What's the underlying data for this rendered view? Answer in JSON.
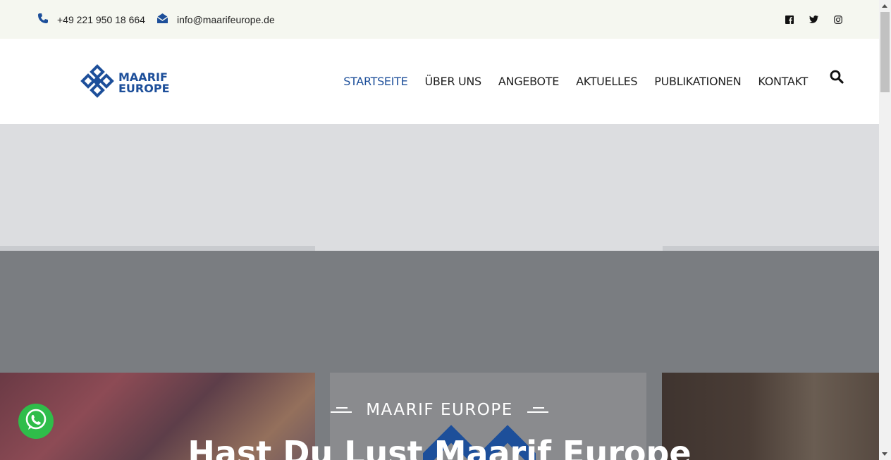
{
  "topbar": {
    "phone": "+49 221 950 18 664",
    "email": "info@maarifeurope.de",
    "social_icons": [
      "facebook-icon",
      "twitter-icon",
      "instagram-icon"
    ]
  },
  "logo": {
    "line1": "MAARIF",
    "line2": "EUROPE"
  },
  "nav": {
    "items": [
      {
        "label": "STARTSEITE",
        "active": true
      },
      {
        "label": "ÜBER UNS"
      },
      {
        "label": "ANGEBOTE"
      },
      {
        "label": "AKTUELLES"
      },
      {
        "label": "PUBLIKATIONEN"
      },
      {
        "label": "KONTAKT"
      }
    ]
  },
  "hero": {
    "tagline": "MAARIF EUROPE",
    "headline": "Hast Du Lust Maarif Europe"
  },
  "colors": {
    "brand": "#1d4f9a",
    "topbar_bg": "#f5f7f0",
    "whatsapp": "#2fbd4a"
  }
}
